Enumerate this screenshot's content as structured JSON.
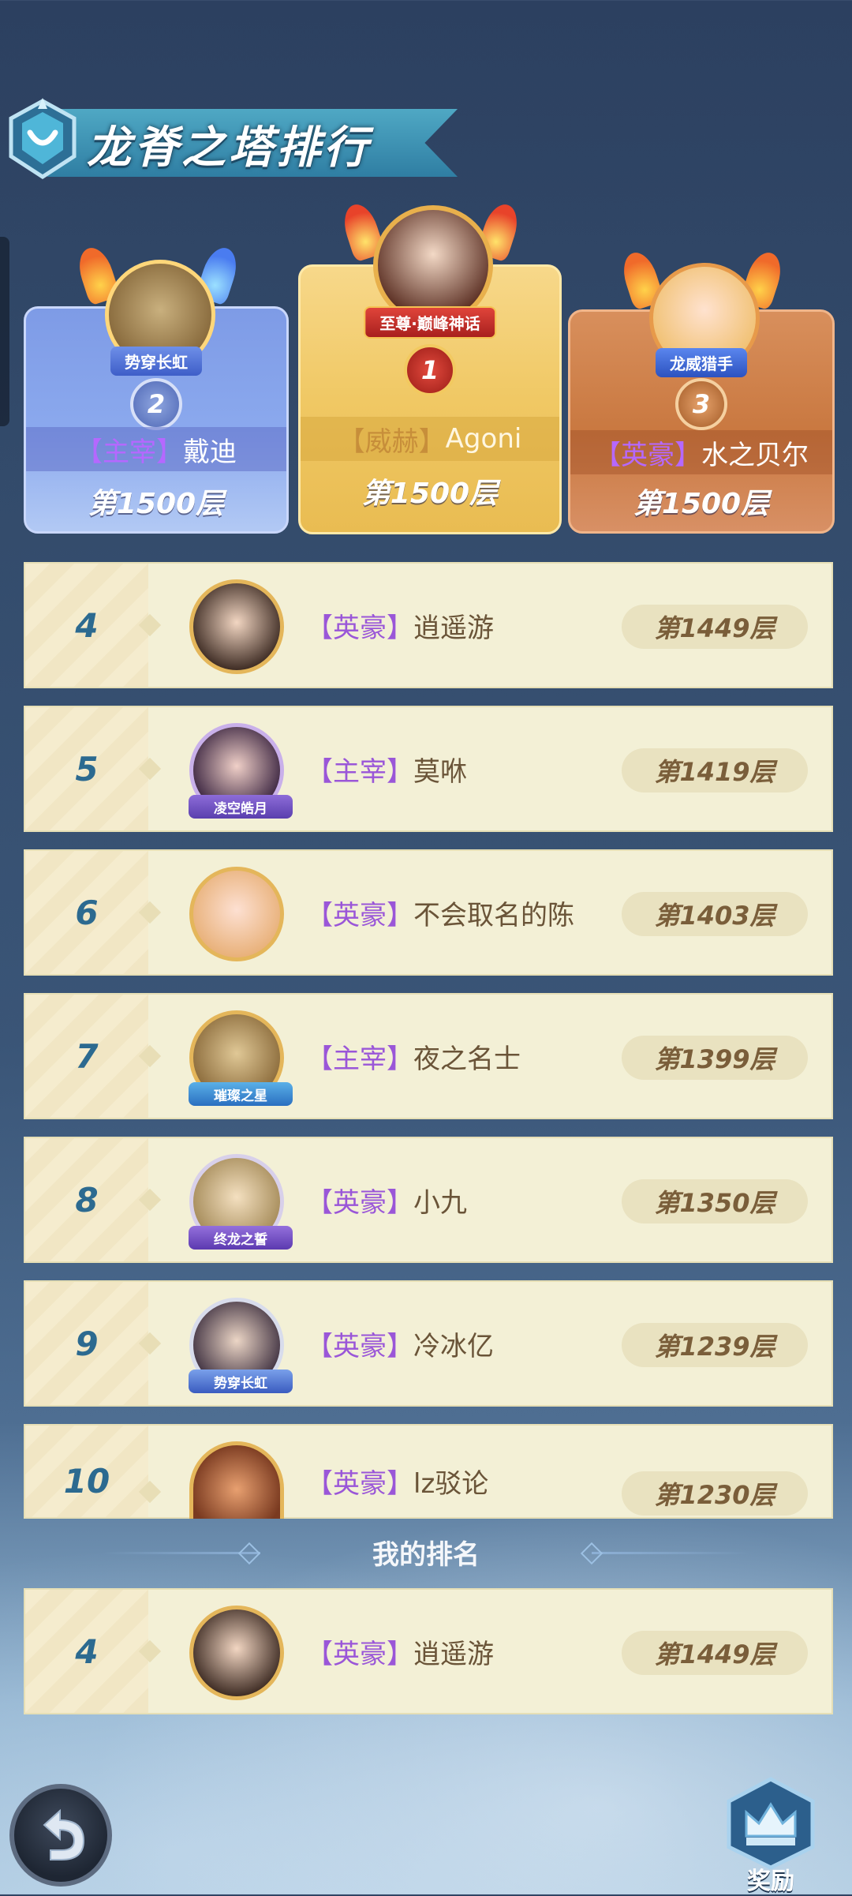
{
  "title": "龙脊之塔排行",
  "top3": [
    {
      "rank": "2",
      "badge": "势穿长虹",
      "tag": "【主宰】",
      "name": "戴迪",
      "floor": "第1500层"
    },
    {
      "rank": "1",
      "badge": "至尊·巅峰神话",
      "tag": "【威赫】",
      "name": "Agoni",
      "floor": "第1500层"
    },
    {
      "rank": "3",
      "badge": "龙威猎手",
      "tag": "【英豪】",
      "name": "水之贝尔",
      "floor": "第1500层"
    }
  ],
  "list": [
    {
      "rank": "4",
      "tag": "【英豪】",
      "name": "逍遥游",
      "floor": "第1449层",
      "avatar_badge": ""
    },
    {
      "rank": "5",
      "tag": "【主宰】",
      "name": "莫咻",
      "floor": "第1419层",
      "avatar_badge": "凌空皓月"
    },
    {
      "rank": "6",
      "tag": "【英豪】",
      "name": "不会取名的陈",
      "floor": "第1403层",
      "avatar_badge": ""
    },
    {
      "rank": "7",
      "tag": "【主宰】",
      "name": "夜之名士",
      "floor": "第1399层",
      "avatar_badge": "璀璨之星"
    },
    {
      "rank": "8",
      "tag": "【英豪】",
      "name": "小九",
      "floor": "第1350层",
      "avatar_badge": "终龙之誓"
    },
    {
      "rank": "9",
      "tag": "【英豪】",
      "name": "冷冰亿",
      "floor": "第1239层",
      "avatar_badge": "势穿长虹"
    },
    {
      "rank": "10",
      "tag": "【英豪】",
      "name": "lz驳论",
      "floor": "第1230层",
      "avatar_badge": ""
    }
  ],
  "my_rank_label": "我的排名",
  "my_rank": {
    "rank": "4",
    "tag": "【英豪】",
    "name": "逍遥游",
    "floor": "第1449层"
  },
  "buttons": {
    "reward_label": "奖励"
  },
  "icons": {
    "back": "back-arrow-icon",
    "reward": "crown-trophy-icon",
    "emblem": "tower-emblem-icon"
  },
  "colors": {
    "gold": "#f0c864",
    "silver": "#8ba9ee",
    "bronze": "#c97840",
    "tag_purple": "#9a56d8",
    "rank_blue": "#2c6a90"
  }
}
